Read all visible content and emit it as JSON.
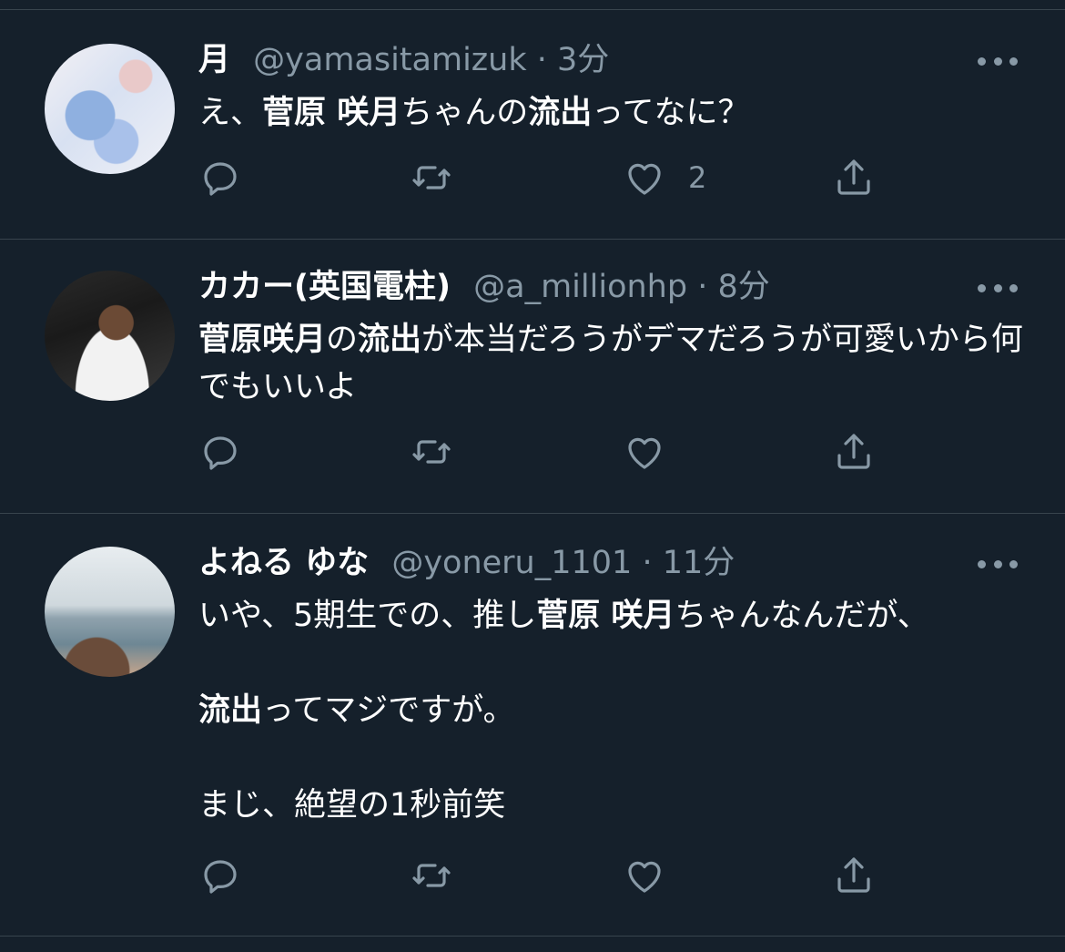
{
  "tweets": [
    {
      "name": "月",
      "handle": "@yamasitamizuk",
      "time": "3分",
      "text_parts": [
        {
          "t": "え、",
          "b": false
        },
        {
          "t": "菅原 咲月",
          "b": true
        },
        {
          "t": "ちゃんの",
          "b": false
        },
        {
          "t": "流出",
          "b": true
        },
        {
          "t": "ってなに？",
          "b": false
        }
      ],
      "likes": "2",
      "avatar": "avatar-flowers"
    },
    {
      "name": "カカー(英国電柱)",
      "handle": "@a_millionhp",
      "time": "8分",
      "text_parts": [
        {
          "t": "菅原咲月",
          "b": true
        },
        {
          "t": "の",
          "b": false
        },
        {
          "t": "流出",
          "b": true
        },
        {
          "t": "が本当だろうがデマだろうが可愛いから何でもいいよ",
          "b": false
        }
      ],
      "likes": "",
      "avatar": "avatar-football-player"
    },
    {
      "name": "よねる ゆな",
      "handle": "@yoneru_1101",
      "time": "11分",
      "text_parts": [
        {
          "t": "いや、5期生での、推し",
          "b": false
        },
        {
          "t": "菅原 咲月",
          "b": true
        },
        {
          "t": "ちゃんなんだが、\n\n",
          "b": false
        },
        {
          "t": "流出",
          "b": true
        },
        {
          "t": "ってマジですが。\n\nまじ、絶望の1秒前笑",
          "b": false
        }
      ],
      "likes": "",
      "avatar": "avatar-seaside"
    }
  ],
  "separator": " · ",
  "icons": {
    "reply": "reply-icon",
    "retweet": "retweet-icon",
    "like": "heart-icon",
    "share": "share-icon",
    "more": "more-icon"
  },
  "colors": {
    "background": "#15202b",
    "secondary_text": "#8899a6",
    "divider": "#38444d"
  }
}
